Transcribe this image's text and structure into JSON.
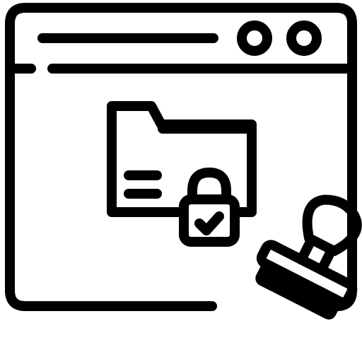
{
  "icon": {
    "name": "secure-approved-folder-browser-icon",
    "style": "line-art",
    "stroke_color": "#000000",
    "background_color": "#ffffff",
    "parts": [
      "browser-window-icon",
      "window-control-dot-icon",
      "address-bar-icon",
      "folder-icon",
      "padlock-icon",
      "checkmark-icon",
      "rubber-stamp-icon"
    ]
  }
}
